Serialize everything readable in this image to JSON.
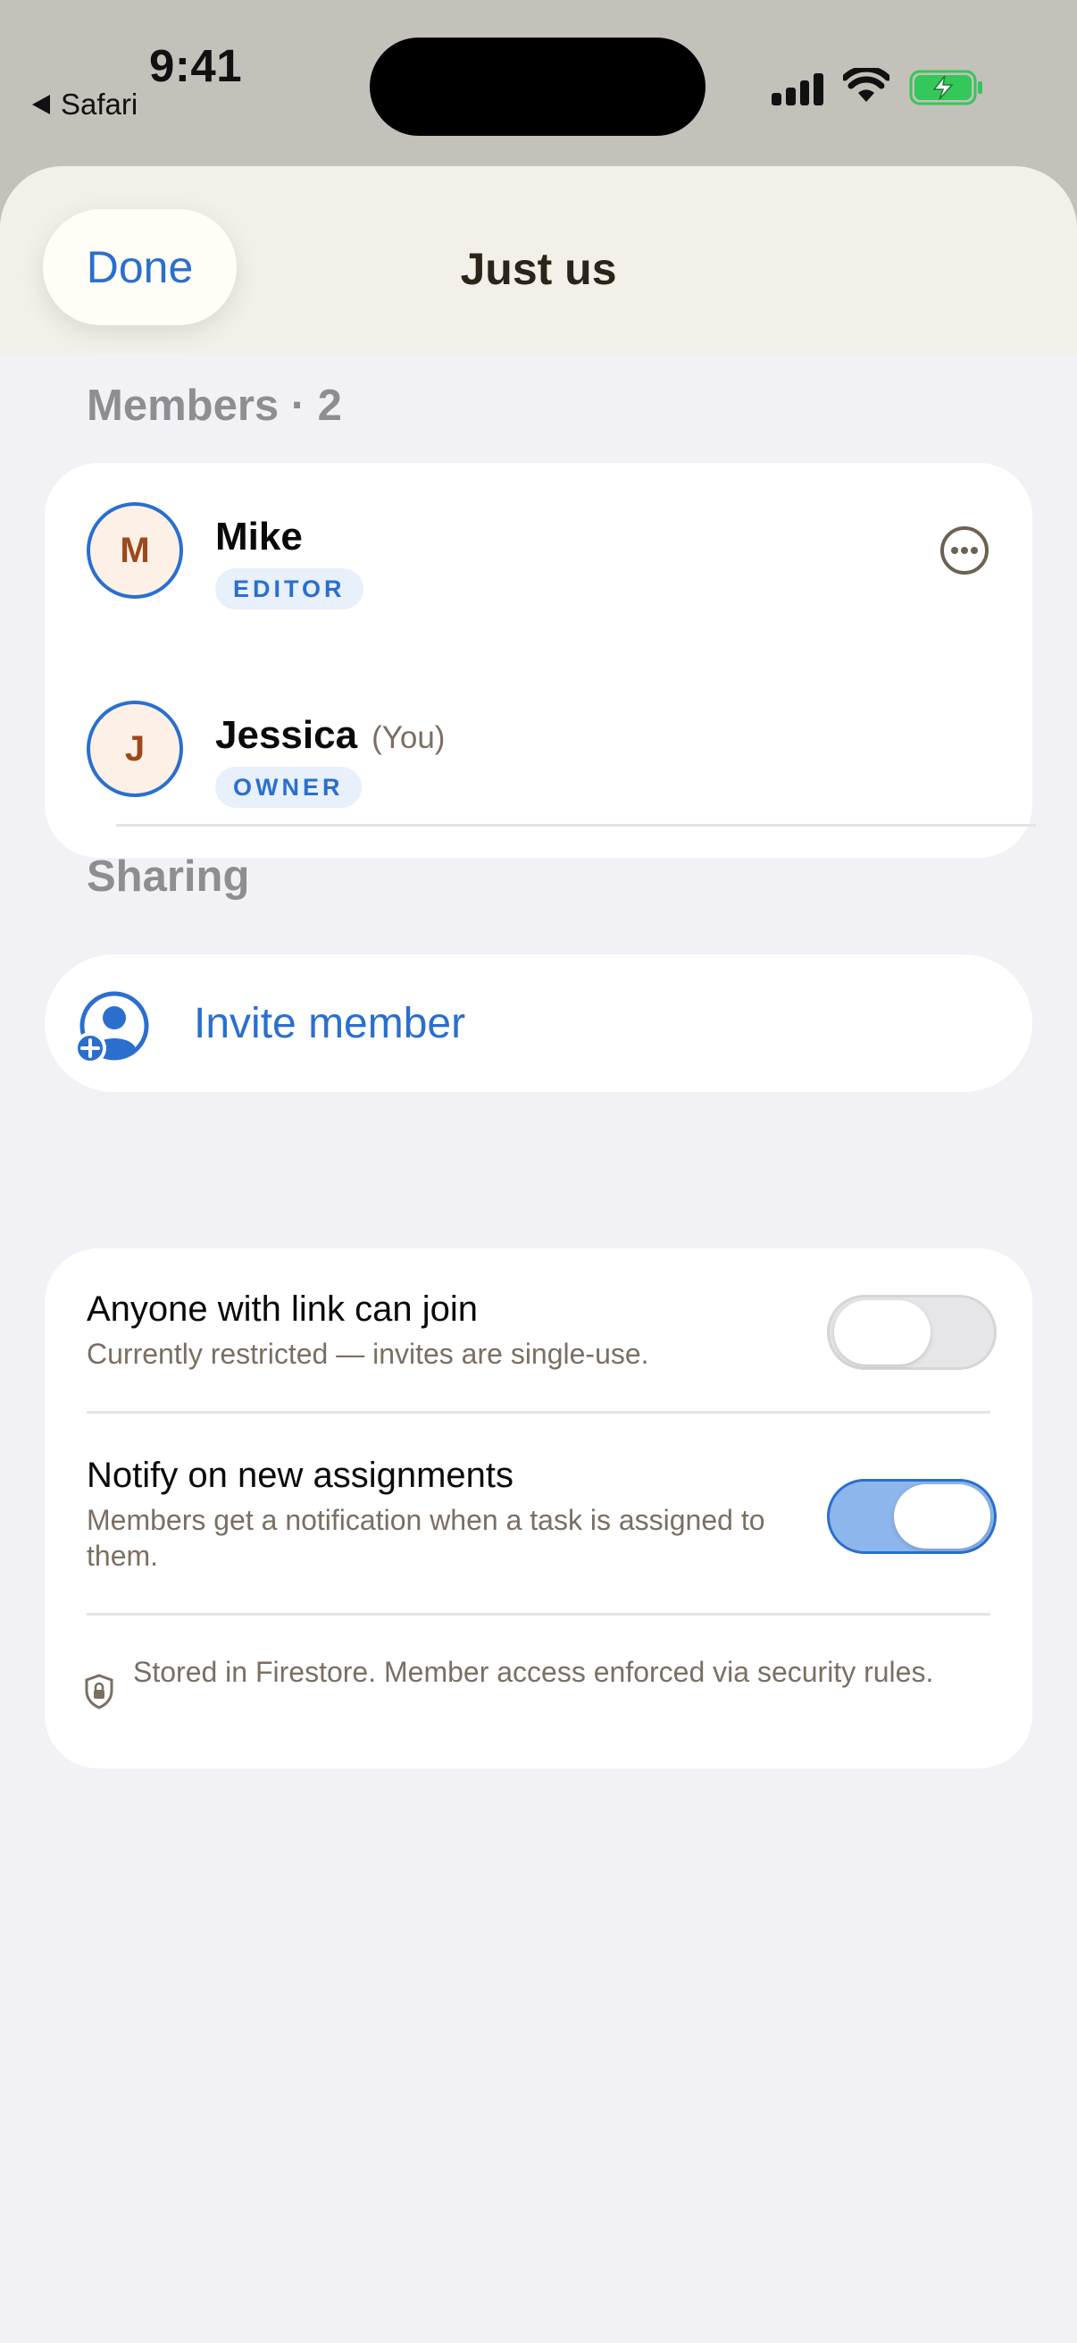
{
  "status_bar": {
    "time": "9:41",
    "back_app": "Safari"
  },
  "nav": {
    "done_label": "Done",
    "title": "Just us"
  },
  "members": {
    "section_label": "Members · 2",
    "items": [
      {
        "initial": "M",
        "name": "Mike",
        "you": "",
        "role": "EDITOR"
      },
      {
        "initial": "J",
        "name": "Jessica",
        "you": "(You)",
        "role": "OWNER"
      }
    ]
  },
  "invite": {
    "label": "Invite member"
  },
  "sharing": {
    "section_label": "Sharing",
    "settings": [
      {
        "title": "Anyone with link can join",
        "description": "Currently restricted — invites are single-use.",
        "enabled": false
      },
      {
        "title": "Notify on new assignments",
        "description": "Members get a notification when a task is assigned to them.",
        "enabled": true
      }
    ],
    "footnote": "Stored in Firestore. Member access enforced via security rules."
  },
  "colors": {
    "accent": "#2a6fce",
    "toggle_on": "#8db6ec",
    "avatar_text": "#9a4a1c",
    "avatar_bg": "#fdf1e7"
  }
}
